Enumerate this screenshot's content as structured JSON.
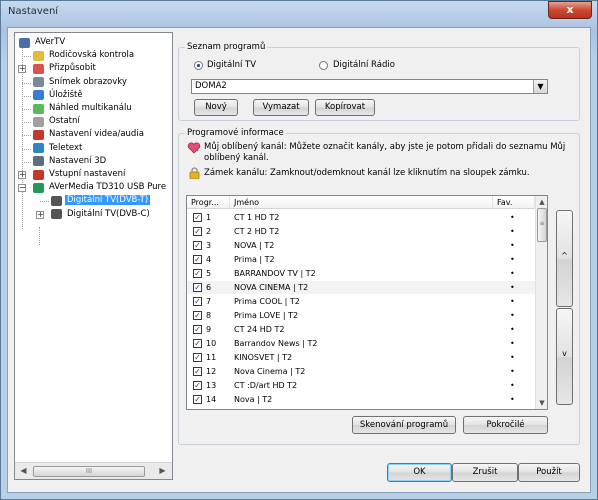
{
  "window": {
    "title": "Nastavení",
    "close_label": "x"
  },
  "tree": {
    "items": [
      {
        "label": "AVerTV",
        "icon": "computer-icon",
        "color": "#4a6fa5"
      },
      {
        "label": "Rodičovská kontrola",
        "icon": "lock-icon",
        "color": "#e7b93a"
      },
      {
        "label": "Přizpůsobit",
        "icon": "customize-icon",
        "color": "#d9534f"
      },
      {
        "label": "Snímek obrazovky",
        "icon": "camera-icon",
        "color": "#7a8a99"
      },
      {
        "label": "Úložiště",
        "icon": "storage-icon",
        "color": "#3a7bd5"
      },
      {
        "label": "Náhled multikanálu",
        "icon": "eye-icon",
        "color": "#5cb85c"
      },
      {
        "label": "Ostatní",
        "icon": "document-icon",
        "color": "#a0a0a0"
      },
      {
        "label": "Nastavení videa/audia",
        "icon": "video-icon",
        "color": "#c0392b"
      },
      {
        "label": "Teletext",
        "icon": "teletext-icon",
        "color": "#2e86c1"
      },
      {
        "label": "Nastavení 3D",
        "icon": "3d-icon",
        "color": "#5d6d7e"
      },
      {
        "label": "Vstupní nastavení",
        "icon": "input-icon",
        "color": "#c0392b"
      },
      {
        "label": "AVerMedia TD310 USB Pure",
        "icon": "device-icon",
        "color": "#229954"
      },
      {
        "label": "Digitální TV(DVB-T)",
        "icon": "tv-icon",
        "color": "#555555"
      },
      {
        "label": "Digitální TV(DVB-C)",
        "icon": "tv-icon",
        "color": "#555555"
      }
    ],
    "hscroll_label": "III"
  },
  "program_list": {
    "title": "Seznam programů",
    "radio_tv": "Digitální TV",
    "radio_radio": "Digitální Rádio",
    "selected_list": "DOMA2",
    "new_button": "Nový",
    "delete_button": "Vymazat",
    "copy_button": "Kopírovat"
  },
  "program_info": {
    "title": "Programové informace",
    "favorite_text": "Můj oblíbený kanál: Můžete označit kanály, aby jste je potom přidali do seznamu Můj oblíbený kanál.",
    "lock_text": "Zámek kanálu: Zamknout/odemknout kanál lze kliknutím na sloupek zámku."
  },
  "table": {
    "columns": [
      "Progr...",
      "Jméno",
      "Fav."
    ],
    "rows": [
      {
        "num": "1",
        "name": "CT 1 HD T2",
        "fav": "•"
      },
      {
        "num": "2",
        "name": "CT 2 HD T2",
        "fav": "•"
      },
      {
        "num": "3",
        "name": "NOVA | T2",
        "fav": "•"
      },
      {
        "num": "4",
        "name": "Prima | T2",
        "fav": "•"
      },
      {
        "num": "5",
        "name": "BARRANDOV TV | T2",
        "fav": "•"
      },
      {
        "num": "6",
        "name": "NOVA CINEMA | T2",
        "fav": "•"
      },
      {
        "num": "7",
        "name": "Prima COOL | T2",
        "fav": "•"
      },
      {
        "num": "8",
        "name": "Prima LOVE | T2",
        "fav": "•"
      },
      {
        "num": "9",
        "name": "CT 24 HD T2",
        "fav": "•"
      },
      {
        "num": "10",
        "name": "Barrandov News | T2",
        "fav": "•"
      },
      {
        "num": "11",
        "name": "KINOSVET | T2",
        "fav": "•"
      },
      {
        "num": "12",
        "name": "Nova Cinema | T2",
        "fav": "•"
      },
      {
        "num": "13",
        "name": "CT :D/art HD T2",
        "fav": "•"
      },
      {
        "num": "14",
        "name": "Nova | T2",
        "fav": "•"
      }
    ],
    "checked": "✓"
  },
  "side_buttons": {
    "up": "^",
    "down": "v"
  },
  "scan_button": "Skenování programů",
  "advanced_button": "Pokročilé",
  "ok_button": "OK",
  "cancel_button": "Zrušit",
  "apply_button": "Použít"
}
